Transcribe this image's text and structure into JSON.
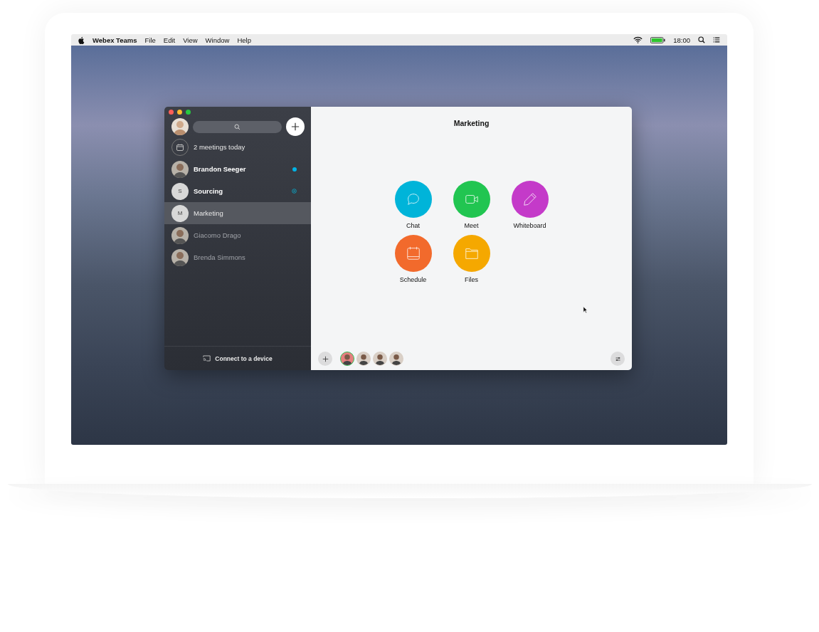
{
  "menu_bar": {
    "app_name": "Webex Teams",
    "menus": [
      "File",
      "Edit",
      "View",
      "Window",
      "Help"
    ],
    "clock": "18:00"
  },
  "sidebar": {
    "meetings": "2 meetings today",
    "conversations": [
      {
        "name": "Brandon Seeger",
        "kind": "person",
        "unread": true,
        "selected": false,
        "unread_dot": true,
        "mentioned": false
      },
      {
        "name": "Sourcing",
        "kind": "space",
        "initial": "S",
        "unread": true,
        "selected": false,
        "unread_dot": false,
        "mentioned": true
      },
      {
        "name": "Marketing",
        "kind": "space",
        "initial": "M",
        "unread": false,
        "selected": true,
        "unread_dot": false,
        "mentioned": false
      },
      {
        "name": "Giacomo Drago",
        "kind": "person",
        "unread": false,
        "selected": false,
        "unread_dot": false,
        "mentioned": false
      },
      {
        "name": "Brenda Simmons",
        "kind": "person",
        "unread": false,
        "selected": false,
        "unread_dot": false,
        "mentioned": false
      }
    ],
    "connect": "Connect to a device"
  },
  "space": {
    "title": "Marketing",
    "actions": [
      {
        "label": "Chat",
        "kind": "chat",
        "color": "#00b4d9"
      },
      {
        "label": "Meet",
        "kind": "meet",
        "color": "#21c551"
      },
      {
        "label": "Whiteboard",
        "kind": "whiteboard",
        "color": "#c43ac9"
      },
      {
        "label": "Schedule",
        "kind": "schedule",
        "color": "#f26a2c"
      },
      {
        "label": "Files",
        "kind": "files",
        "color": "#f5a800"
      }
    ],
    "participants": [
      {
        "active": true
      },
      {
        "active": false
      },
      {
        "active": false
      },
      {
        "active": false
      }
    ]
  }
}
